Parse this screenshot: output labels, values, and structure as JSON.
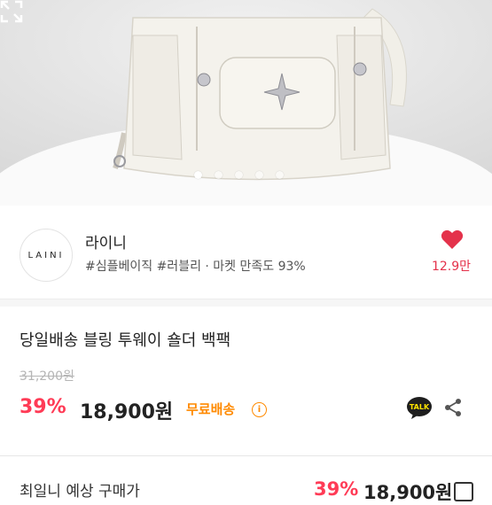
{
  "image": {
    "carousel_dots": 5,
    "active_dot": 0,
    "expand_icon": "expand-icon"
  },
  "seller": {
    "logo_text": "LAINI",
    "name": "라이니",
    "meta": "#심플베이직 #러블리 · 마켓 만족도 93%",
    "likes": "12.9만",
    "heart_color": "#e4324b"
  },
  "product": {
    "title": "당일배송 블링 투웨이 숄더 백팩",
    "original_price": "31,200원",
    "discount": "39%",
    "price": "18,900원",
    "free_shipping": "무료배송",
    "info_icon": "i",
    "talk_label": "TALK"
  },
  "bottom_bar": {
    "left_text": "최일니 예상 구매가",
    "discount": "39%",
    "price": "18,900원"
  },
  "colors": {
    "accent_red": "#ff3b56",
    "shipping_orange": "#ff8a00"
  }
}
